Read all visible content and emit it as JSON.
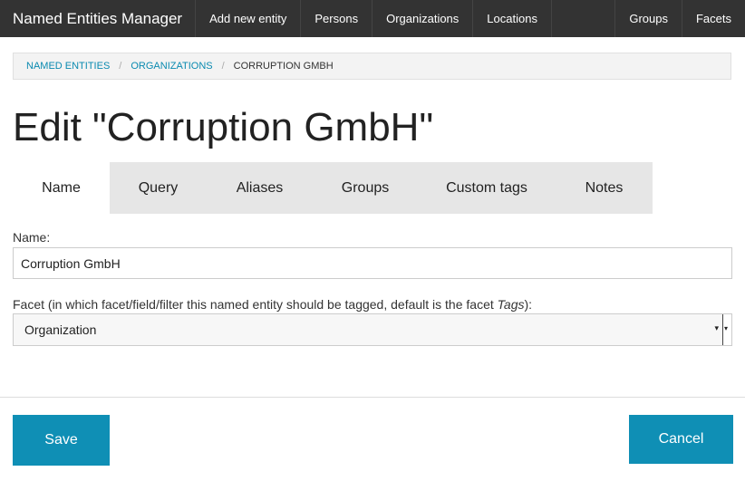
{
  "header": {
    "brand": "Named Entities Manager",
    "nav_left": [
      "Add new entity",
      "Persons",
      "Organizations",
      "Locations"
    ],
    "nav_right": [
      "Groups",
      "Facets"
    ]
  },
  "breadcrumb": {
    "items": [
      "NAMED ENTITIES",
      "ORGANIZATIONS"
    ],
    "separator": "/",
    "current": "CORRUPTION GMBH"
  },
  "page": {
    "title": "Edit \"Corruption GmbH\""
  },
  "tabs": {
    "active": "Name",
    "items": [
      "Name",
      "Query",
      "Aliases",
      "Groups",
      "Custom tags",
      "Notes"
    ]
  },
  "form": {
    "name_label": "Name:",
    "name_value": "Corruption GmbH",
    "facet_label_prefix": "Facet (in which facet/field/filter this named entity should be tagged, default is the facet ",
    "facet_label_em": "Tags",
    "facet_label_suffix": "):",
    "facet_selected": "Organization",
    "facet_arrow": "▾"
  },
  "actions": {
    "save_label": "Save",
    "cancel_label": "Cancel"
  },
  "colors": {
    "topbar": "#333333",
    "accent": "#0f8fb5",
    "link": "#0a8ab0",
    "tab_inactive_bg": "#e6e6e6"
  }
}
